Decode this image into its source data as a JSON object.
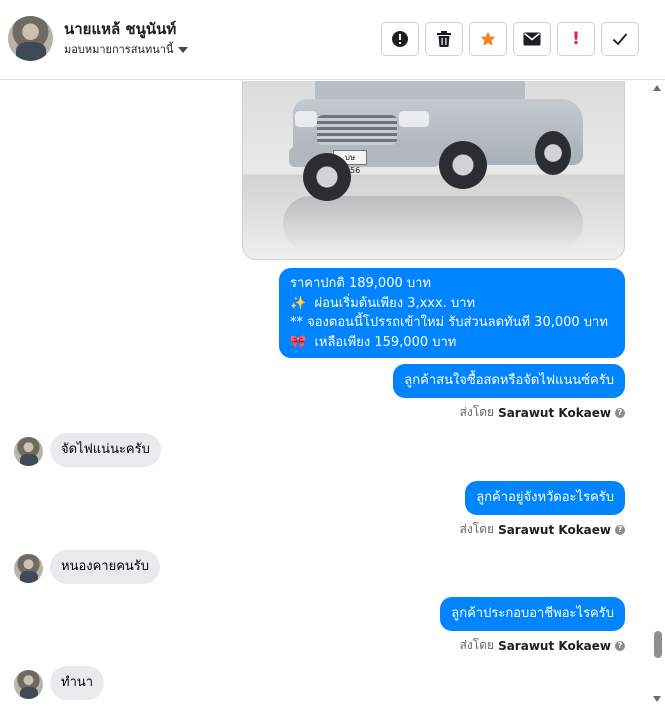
{
  "header": {
    "contact_name": "นายแหล้ ชนูนันท์",
    "assignment_label": "มอบหมายการสนทนานี้"
  },
  "toolbar": {
    "buttons": [
      {
        "icon": "alert-circle-icon"
      },
      {
        "icon": "trash-icon"
      },
      {
        "icon": "star-icon",
        "color": "#f5821f"
      },
      {
        "icon": "envelope-icon"
      },
      {
        "icon": "exclamation-icon",
        "label": "!",
        "color": "#e41e3f"
      },
      {
        "icon": "check-icon"
      }
    ]
  },
  "messages": {
    "price_card": {
      "line1": "ราคาปกติ  189,000 บาท",
      "line2_emoji": "✨",
      "line2": "ผ่อนเริ่มต้นเพียง 3,xxx. บาท",
      "line3": "** จองตอนนี้โปรรถเข้าใหม่ รับส่วนลดทันที 30,000 บาท",
      "line4_emoji": "🎀",
      "line4": "เหลือเพียง 159,000 บาท"
    },
    "out1": "ลูกค้าสนใจซื้อสดหรือจัดไฟแนนซ์ครับ",
    "in1": "จัดไฟแน่นะครับ",
    "out2": "ลูกค้าอยู่จังหวัดอะไรครับ",
    "in2": "หนองคายคนรับ",
    "out3": "ลูกค้าประกอบอาชีพอะไรครับ",
    "in3": "ทำนา"
  },
  "sent_by": {
    "prefix": "ส่งโดย",
    "sender": "Sarawut Kokaew",
    "info": "?"
  },
  "car_photo": {
    "plate": "บษ 6056"
  },
  "colors": {
    "outgoing_bubble": "#0084ff",
    "incoming_bubble": "#e9eaec"
  }
}
